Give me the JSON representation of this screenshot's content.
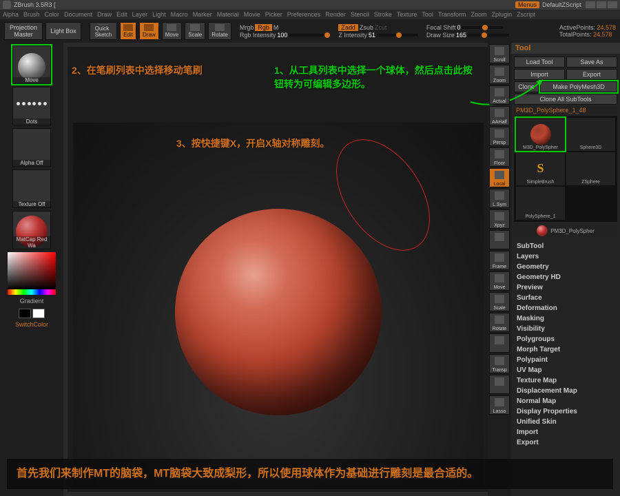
{
  "app": {
    "title": "ZBrush 3.5R3  [",
    "menus": "Menus",
    "script": "DefaultZScript"
  },
  "menu": [
    "Alpha",
    "Brush",
    "Color",
    "Document",
    "Draw",
    "Edit",
    "Layer",
    "Light",
    "Macro",
    "Marker",
    "Material",
    "Movie",
    "Picker",
    "Preferences",
    "Render",
    "Stencil",
    "Stroke",
    "Texture",
    "Tool",
    "Transform",
    "Zoom",
    "Zplugin",
    "Zscript"
  ],
  "toolbar": {
    "projection": "Projection\nMaster",
    "lightbox": "Light Box",
    "quicksketch": "Quick\nSketch",
    "edit": "Edit",
    "draw": "Draw",
    "move": "Move",
    "scale": "Scale",
    "rotate": "Rotate",
    "mrgb": "Mrgb",
    "rgb": "Rgb",
    "m": "M",
    "rgb_int": "Rgb Intensity",
    "rgb_int_v": "100",
    "zadd": "Zadd",
    "zsub": "Zsub",
    "zcut": "Zcut",
    "z_int": "Z Intensity",
    "z_int_v": "51",
    "focal": "Focal Shift",
    "focal_v": "0",
    "drawsize": "Draw Size",
    "drawsize_v": "165",
    "active": "ActivePoints:",
    "active_v": "24,578",
    "total": "TotalPoints:",
    "total_v": "24,578"
  },
  "left": {
    "brush": "Move",
    "stroke": "Dots",
    "alpha": "Alpha Off",
    "texture": "Texture Off",
    "material": "MatCap Red Wa",
    "gradient": "Gradient",
    "switch": "SwitchColor"
  },
  "shelf": [
    "Scroll",
    "Zoom",
    "Actual",
    "AAHalf",
    "Persp",
    "Floor",
    "Local",
    "L.Sym",
    "Xpyz",
    "",
    "Frame",
    "Move",
    "Scale",
    "Rotate",
    "",
    "Transp",
    "",
    "Lasso"
  ],
  "shelf_active_idx": 6,
  "tool": {
    "title": "Tool",
    "load": "Load Tool",
    "save": "Save As",
    "import": "Import",
    "export": "Export",
    "clone": "Clone",
    "make": "Make PolyMesh3D",
    "cloneall": "Clone All SubTools",
    "current": "PM3D_PolySphere_1_48",
    "items": [
      {
        "name": "M3D_PolySpher",
        "color": "#b9452f"
      },
      {
        "name": "Sphere3D",
        "color": "#a33"
      },
      {
        "name": "SimpleBrush",
        "color": "#d90",
        "letter": "S"
      },
      {
        "name": "ZSphere",
        "color": "#a33"
      },
      {
        "name": "PolySphere_1",
        "color": "#a33"
      }
    ],
    "selected": "PM3D_PolySpher",
    "sections": [
      "SubTool",
      "Layers",
      "Geometry",
      "Geometry HD",
      "Preview",
      "Surface",
      "Deformation",
      "Masking",
      "Visibility",
      "Polygroups",
      "Morph Target",
      "Polypaint",
      "UV Map",
      "Texture Map",
      "Displacement Map",
      "Normal Map",
      "Display Properties",
      "Unified Skin",
      "Import",
      "Export"
    ]
  },
  "annotations": {
    "a1": "1、从工具列表中选择一个球体，然后点击此按钮转为可编辑多边形。",
    "a2": "2、在笔刷列表中选择移动笔刷",
    "a3": "3、按快捷键X，开启X轴对称雕刻。"
  },
  "caption": "首先我们来制作MT的脑袋，MT脑袋大致成梨形，所以使用球体作为基础进行雕刻是最合适的。"
}
